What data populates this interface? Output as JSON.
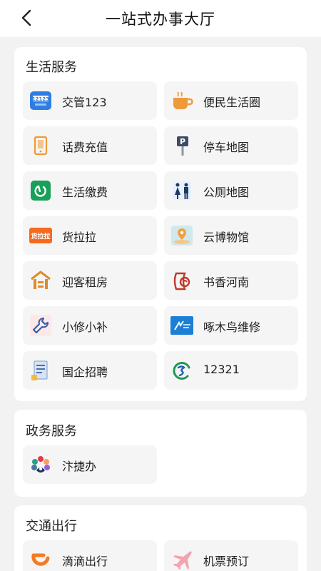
{
  "header": {
    "title": "一站式办事大厅",
    "back_icon": "chevron-left-icon"
  },
  "sections": [
    {
      "title": "生活服务",
      "items": [
        {
          "label": "交管123",
          "icon": "traffic-12123-icon"
        },
        {
          "label": "便民生活圈",
          "icon": "coffee-cup-icon"
        },
        {
          "label": "话费充值",
          "icon": "phone-recharge-icon"
        },
        {
          "label": "停车地图",
          "icon": "parking-sign-icon"
        },
        {
          "label": "生活缴费",
          "icon": "bill-payment-icon"
        },
        {
          "label": "公厕地图",
          "icon": "restroom-icon"
        },
        {
          "label": "货拉拉",
          "icon": "huolala-logo-icon"
        },
        {
          "label": "云博物馆",
          "icon": "museum-location-icon"
        },
        {
          "label": "迎客租房",
          "icon": "house-rental-icon"
        },
        {
          "label": "书香河南",
          "icon": "book-henan-icon"
        },
        {
          "label": "小修小补",
          "icon": "wrench-icon"
        },
        {
          "label": "啄木鸟维修",
          "icon": "woodpecker-logo-icon"
        },
        {
          "label": "国企招聘",
          "icon": "recruit-document-icon"
        },
        {
          "label": "12321",
          "icon": "report-12321-icon"
        }
      ]
    },
    {
      "title": "政务服务",
      "items": [
        {
          "label": "汴捷办",
          "icon": "bianjieban-logo-icon"
        }
      ]
    },
    {
      "title": "交通出行",
      "items": [
        {
          "label": "滴滴出行",
          "icon": "didi-logo-icon"
        },
        {
          "label": "机票预订",
          "icon": "airplane-icon"
        }
      ]
    }
  ],
  "colors": {
    "accent_orange": "#e88a2e",
    "accent_green": "#18a058",
    "accent_blue": "#1e6fd9"
  }
}
